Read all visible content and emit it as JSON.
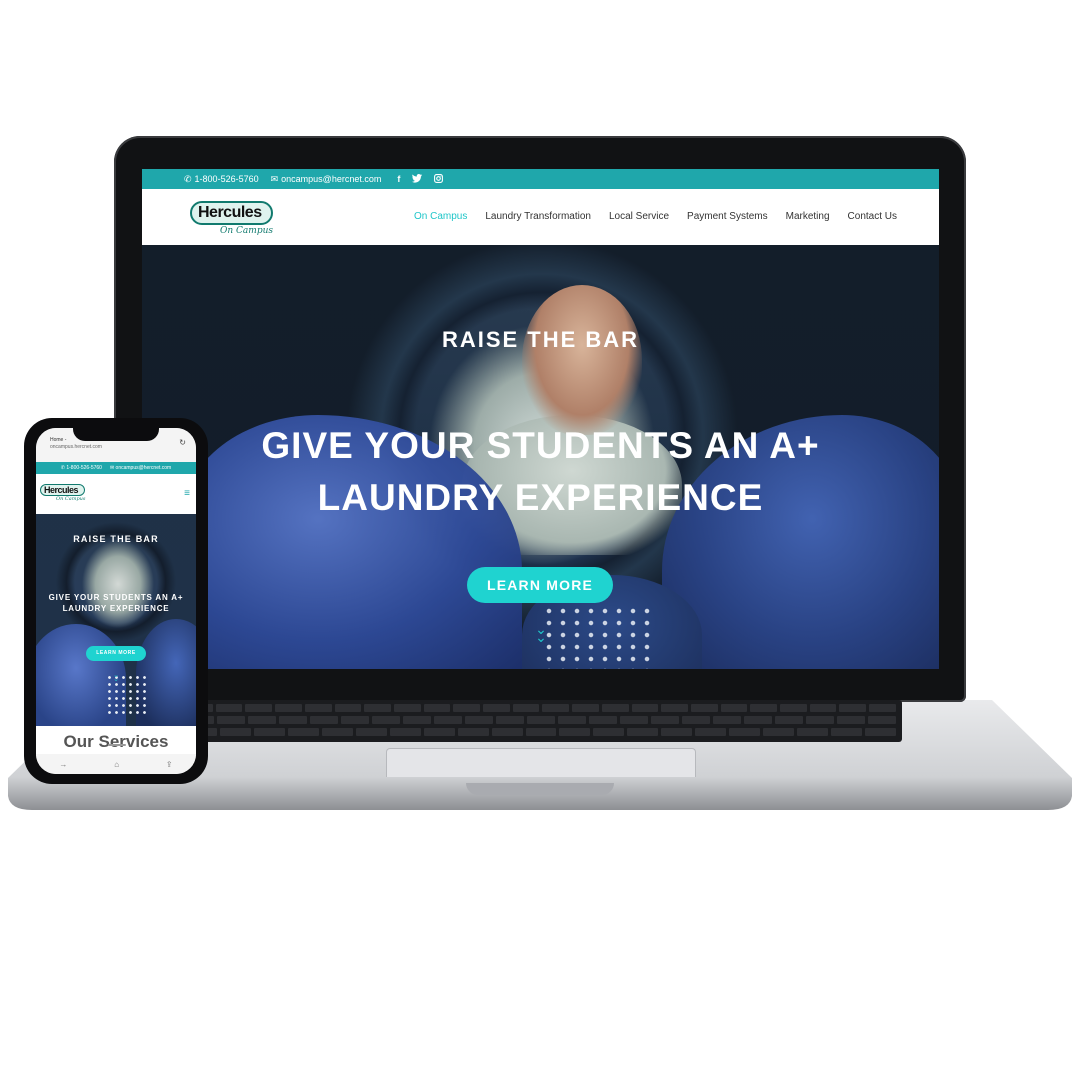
{
  "desktop": {
    "topbar": {
      "phone": "1-800-526-5760",
      "email": "oncampus@hercnet.com",
      "social": [
        "facebook-icon",
        "twitter-icon",
        "instagram-icon"
      ]
    },
    "logo": {
      "brand": "Hercules",
      "sub": "On Campus"
    },
    "nav": [
      "On Campus",
      "Laundry Transformation",
      "Local Service",
      "Payment Systems",
      "Marketing",
      "Contact Us"
    ],
    "hero": {
      "subtitle": "RAISE THE BAR",
      "title_line1": "GIVE YOUR STUDENTS AN A+",
      "title_line2": "LAUNDRY EXPERIENCE",
      "button": "LEARN MORE"
    }
  },
  "mobile": {
    "url_title": "Home -",
    "url": "oncampus.hercnet.com",
    "topbar": {
      "phone": "1-800-526-5760",
      "email": "oncampus@hercnet.com"
    },
    "logo": {
      "brand": "Hercules",
      "sub": "On Campus"
    },
    "hero": {
      "subtitle": "RAISE THE BAR",
      "title_line1": "GIVE YOUR STUDENTS AN A+",
      "title_line2": "LAUNDRY EXPERIENCE",
      "button": "LEARN MORE"
    },
    "section_heading": "Our Services"
  },
  "colors": {
    "accent": "#1fa7ab",
    "button": "#1fd3d0",
    "nav_active": "#1fc6c9"
  }
}
